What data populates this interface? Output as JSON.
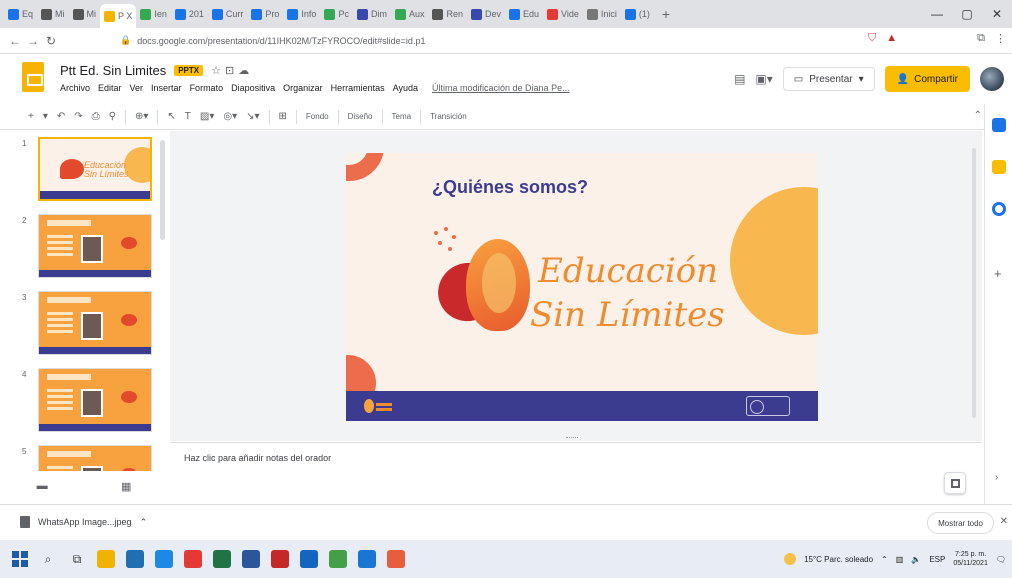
{
  "browser": {
    "tabs": [
      {
        "label": "Eq",
        "color": "#1a73e8"
      },
      {
        "label": "Mi",
        "color": "#555"
      },
      {
        "label": "Mi",
        "color": "#555"
      },
      {
        "label": "P X",
        "color": "#f4b400",
        "active": true
      },
      {
        "label": "Ien",
        "color": "#34a853"
      },
      {
        "label": "201",
        "color": "#1a73e8"
      },
      {
        "label": "Curr",
        "color": "#1a73e8"
      },
      {
        "label": "Pro",
        "color": "#1a73e8"
      },
      {
        "label": "Info",
        "color": "#1a73e8"
      },
      {
        "label": "Pc",
        "color": "#34a853"
      },
      {
        "label": "Dim",
        "color": "#3949ab"
      },
      {
        "label": "Aux",
        "color": "#34a853"
      },
      {
        "label": "Ren",
        "color": "#555"
      },
      {
        "label": "Dev",
        "color": "#3949ab"
      },
      {
        "label": "Edu",
        "color": "#1a73e8"
      },
      {
        "label": "Vide",
        "color": "#e53935"
      },
      {
        "label": "Inici",
        "color": "#777"
      },
      {
        "label": "(1)",
        "color": "#1a73e8"
      }
    ],
    "new_tab": "+",
    "window_controls": {
      "minimize": "—",
      "maximize": "▢",
      "close": "✕"
    },
    "url": "docs.google.com/presentation/d/11IHK02M/TzFYROCO/edit#slide=id.p1"
  },
  "app": {
    "title": "Ptt Ed. Sin Limites",
    "badge": "PPTX",
    "menu": [
      "Archivo",
      "Editar",
      "Ver",
      "Insertar",
      "Formato",
      "Diapositiva",
      "Organizar",
      "Herramientas",
      "Ayuda"
    ],
    "last_edit": "Última modificación de Diana Pe...",
    "present_label": "Presentar",
    "share_label": "Compartir"
  },
  "toolbar": {
    "fondo": "Fondo",
    "diseno": "Diseño",
    "tema": "Tema",
    "transicion": "Transición"
  },
  "filmstrip": {
    "slides": [
      {
        "num": "1",
        "kind": "cover",
        "brand_l1": "Educación",
        "brand_l2": "Sin Límites"
      },
      {
        "num": "2",
        "kind": "profile"
      },
      {
        "num": "3",
        "kind": "profile"
      },
      {
        "num": "4",
        "kind": "profile"
      },
      {
        "num": "5",
        "kind": "profile"
      }
    ]
  },
  "slide": {
    "title": "¿Quiénes somos?",
    "brand_line1": "Educación",
    "brand_line2": "Sin Límites"
  },
  "notes": {
    "placeholder": "Haz clic para añadir notas del orador"
  },
  "download": {
    "file": "WhatsApp Image...jpeg",
    "show_all": "Mostrar todo"
  },
  "taskbar": {
    "apps": [
      "#f0b400",
      "#1f6fb2",
      "#1e88e5",
      "#e53935",
      "#217346",
      "#2b579a",
      "#c62828",
      "#1565c0",
      "#43a047",
      "#1976d2",
      "#e85d3c"
    ],
    "weather": "15°C  Parc. soleado",
    "lang": "ESP",
    "time": "7:25 p. m.",
    "date": "05/11/2021"
  },
  "colors": {
    "accent_yellow": "#fbbc04",
    "slide_purple": "#3b3c8f",
    "slide_orange": "#f8b74f",
    "slide_coral": "#ec6c4b"
  }
}
